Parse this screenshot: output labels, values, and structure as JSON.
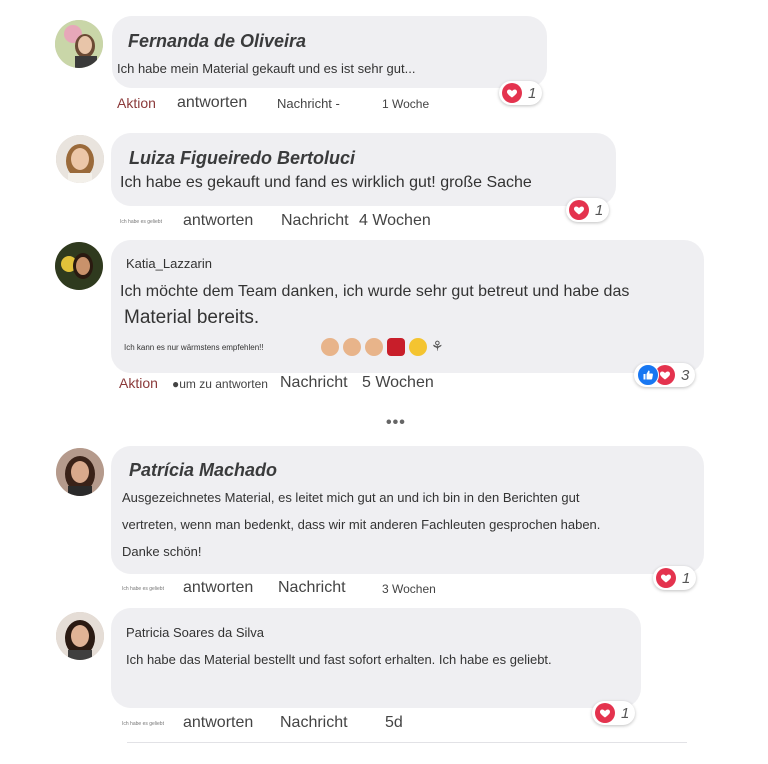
{
  "comments": [
    {
      "name": "Fernanda de Oliveira",
      "text": [
        "Ich habe mein Material gekauft und es ist sehr gut..."
      ],
      "actions": {
        "left": "Aktion",
        "reply": "antworten",
        "message": "Nachricht -",
        "time": "1 Woche"
      },
      "reaction_count": "1"
    },
    {
      "name": "Luiza Figueiredo Bertoluci",
      "text": [
        "Ich habe es gekauft und fand es wirklich gut! große Sache"
      ],
      "actions": {
        "left": "Ich habe es geliebt",
        "reply": "antworten",
        "message": "Nachricht",
        "time": "4 Wochen"
      },
      "reaction_count": "1"
    },
    {
      "name": "Katia_Lazzarin",
      "text": [
        "Ich möchte dem Team danken, ich wurde sehr gut betreut und habe das",
        "Material bereits.",
        "Ich kann es nur wärmstens empfehlen!!"
      ],
      "actions": {
        "left": "Aktion",
        "reply": "●um zu antworten",
        "message": "Nachricht",
        "time": "5 Wochen"
      },
      "reaction_count": "3"
    },
    {
      "name": "Patrícia Machado",
      "text": [
        "Ausgezeichnetes Material, es leitet mich gut an und ich bin in den Berichten gut",
        "vertreten, wenn man bedenkt, dass wir mit anderen Fachleuten gesprochen haben.",
        "Danke schön!"
      ],
      "actions": {
        "left": "Ich habe es geliebt",
        "reply": "antworten",
        "message": "Nachricht",
        "time": "3 Wochen"
      },
      "reaction_count": "1"
    },
    {
      "name": "Patricia Soares da Silva",
      "text": [
        "Ich habe das Material bestellt und fast sofort erhalten. Ich habe es geliebt."
      ],
      "actions": {
        "left": "Ich habe es geliebt",
        "reply": "antworten",
        "message": "Nachricht",
        "time": "5d"
      },
      "reaction_count": "1"
    }
  ],
  "more_replies": "•••",
  "icons": {
    "reaction_heart": "heart-icon",
    "reaction_like": "like-icon"
  },
  "colors": {
    "bubble": "#efeff2",
    "heart": "#e4334e",
    "like": "#1877f2",
    "action_red": "#8b3a3a"
  }
}
